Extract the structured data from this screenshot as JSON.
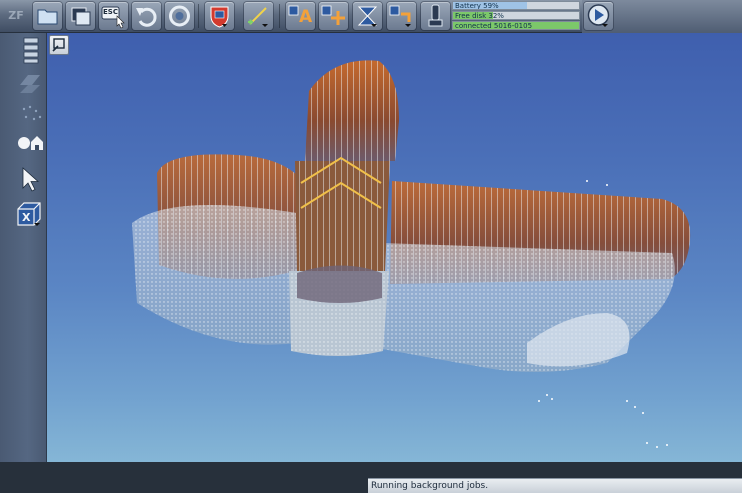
{
  "app": {
    "logo_text": "ZF"
  },
  "toolbar": {
    "buttons": [
      {
        "name": "open-folder",
        "icon": "folder-icon"
      },
      {
        "name": "window",
        "icon": "window-icon"
      },
      {
        "name": "escape",
        "icon": "esc-icon",
        "label": "ESC"
      },
      {
        "name": "undo",
        "icon": "undo-icon"
      },
      {
        "name": "refresh",
        "icon": "refresh-icon"
      },
      {
        "name": "shield",
        "icon": "shield-icon"
      },
      {
        "name": "measure",
        "icon": "measure-icon"
      },
      {
        "name": "annotate",
        "icon": "text-annotate-icon",
        "label": "A"
      },
      {
        "name": "move",
        "icon": "move-icon"
      },
      {
        "name": "clip",
        "icon": "hourglass-icon"
      },
      {
        "name": "transfer",
        "icon": "transfer-icon"
      },
      {
        "name": "scanner",
        "icon": "scanner-icon"
      },
      {
        "name": "play",
        "icon": "play-icon"
      }
    ],
    "gauges": {
      "battery": {
        "label": "Battery 59%",
        "level": 0.59,
        "color": "#9fc3e6"
      },
      "disk": {
        "label": "Free disk 32%",
        "level": 0.32,
        "color": "#7cc86a"
      },
      "connection": {
        "label": "connected 5016-0105",
        "level": 1.0,
        "color": "#7cc86a"
      }
    }
  },
  "sidebar": {
    "tools": [
      {
        "name": "layers",
        "icon": "layers-icon"
      },
      {
        "name": "scan-station",
        "icon": "scan-station-icon"
      },
      {
        "name": "points",
        "icon": "points-icon"
      },
      {
        "name": "home-view",
        "icon": "home-view-icon"
      },
      {
        "name": "select",
        "icon": "cursor-icon"
      },
      {
        "name": "box-x",
        "icon": "box-x-icon",
        "label": "X"
      }
    ]
  },
  "viewport": {
    "view_mode_icon": "view-mode-icon",
    "colors": {
      "sky_top": "#3f5fae",
      "sky_bottom": "#85b6d6",
      "roof": "#a8562a",
      "scan_points": "#e8eef5"
    }
  },
  "status": {
    "text": "Running background jobs."
  }
}
